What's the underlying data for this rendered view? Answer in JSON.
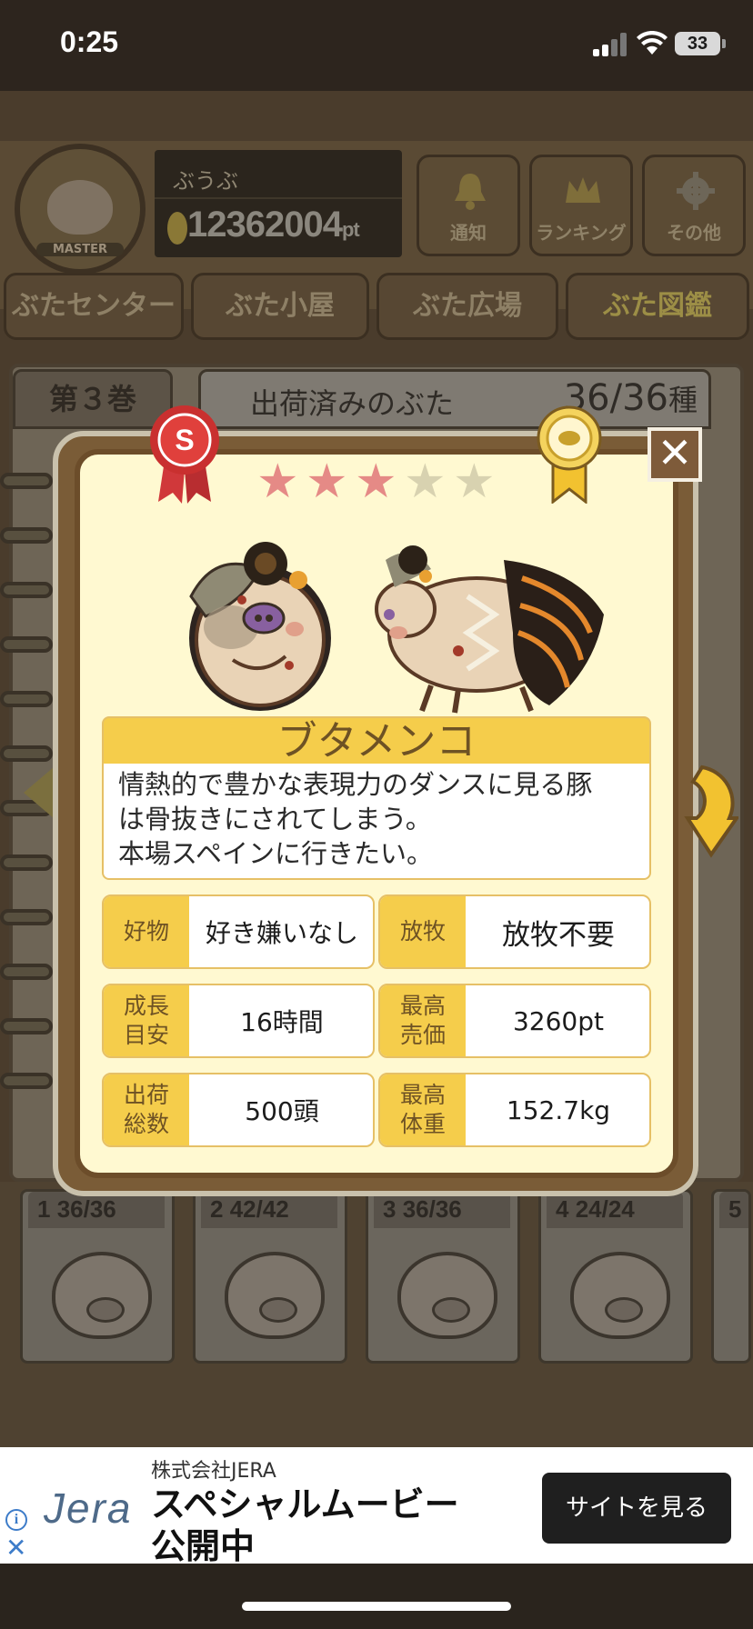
{
  "status": {
    "time": "0:25",
    "battery": "33"
  },
  "header": {
    "badge_label": "MASTER",
    "username": "ぶうぶ",
    "points": "12362004",
    "points_unit": "pt",
    "buttons": [
      {
        "label": "通知",
        "icon": "bell-icon"
      },
      {
        "label": "ランキング",
        "icon": "crown-icon"
      },
      {
        "label": "その他",
        "icon": "gear-icon"
      }
    ]
  },
  "nav": {
    "tabs": [
      "ぶたセンター",
      "ぶた小屋",
      "ぶた広場",
      "ぶた図鑑"
    ],
    "active": "ぶた図鑑"
  },
  "book": {
    "volume": "第３巻",
    "shipped_label": "出荷済みのぶた",
    "shipped_count": "36/36",
    "count_unit": "種"
  },
  "volumes": [
    {
      "num": "1",
      "count": "36/36"
    },
    {
      "num": "2",
      "count": "42/42"
    },
    {
      "num": "3",
      "count": "36/36"
    },
    {
      "num": "4",
      "count": "24/24"
    },
    {
      "num": "5",
      "count": ""
    }
  ],
  "pig": {
    "rank_badge": "S",
    "stars_filled": 3,
    "stars_total": 5,
    "name": "ブタメンコ",
    "description": "情熱的で豊かな表現力のダンスに見る豚\nは骨抜きにされてしまう。\n本場スペインに行きたい。",
    "stats": [
      {
        "label": "好物",
        "value": "好き嫌いなし"
      },
      {
        "label": "放牧",
        "value": "放牧不要"
      },
      {
        "label": "成長\n目安",
        "value": "16時間"
      },
      {
        "label": "最高\n売価",
        "value": "3260pt"
      },
      {
        "label": "出荷\n総数",
        "value": "500頭"
      },
      {
        "label": "最高\n体重",
        "value": "152.7kg"
      }
    ]
  },
  "close_label": "✕",
  "ad": {
    "company": "株式会社JERA",
    "logo": "Jera",
    "headline": "スペシャルムービー\n公開中",
    "cta": "サイトを見る"
  }
}
